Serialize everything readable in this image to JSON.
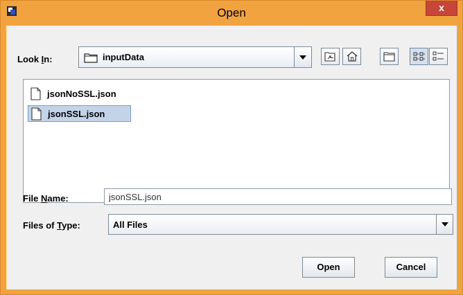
{
  "window": {
    "title": "Open",
    "close_glyph": "x",
    "accent": "#f0a33e",
    "close_color": "#c7463a"
  },
  "look_in": {
    "label_pre": "Look ",
    "label_key": "I",
    "label_post": "n:",
    "value": "inputData",
    "icon": "folder-icon"
  },
  "toolbar": {
    "icons": [
      "up-one-level-icon",
      "home-icon",
      "new-folder-icon",
      "list-view-icon",
      "details-view-icon"
    ]
  },
  "files": [
    {
      "name": "jsonNoSSL.json",
      "icon": "file-icon",
      "selected": false
    },
    {
      "name": "jsonSSL.json",
      "icon": "file-icon",
      "selected": true
    }
  ],
  "file_name": {
    "label_pre": "File ",
    "label_key": "N",
    "label_post": "ame:",
    "value": "jsonSSL.json"
  },
  "file_type": {
    "label_pre": "Files of ",
    "label_key": "T",
    "label_post": "ype:",
    "value": "All Files"
  },
  "buttons": {
    "open": "Open",
    "cancel": "Cancel"
  }
}
